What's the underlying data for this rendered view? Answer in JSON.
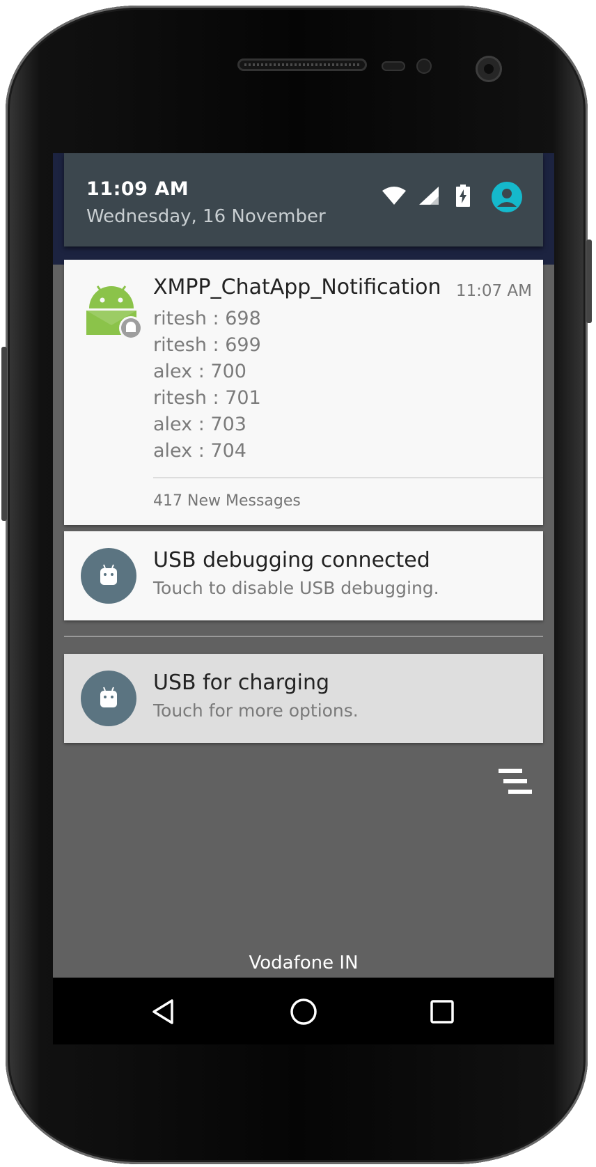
{
  "header": {
    "time": "11:09 AM",
    "date": "Wednesday, 16 November",
    "icons": [
      "wifi-icon",
      "cell-signal-icon",
      "battery-charging-icon",
      "user-avatar-icon"
    ]
  },
  "notifications": {
    "xmpp": {
      "title": "XMPP_ChatApp_Notification",
      "time": "11:07 AM",
      "messages": [
        "ritesh : 698",
        "ritesh : 699",
        "alex : 700",
        "ritesh : 701",
        "alex : 703",
        "alex : 704"
      ],
      "summary": "417 New Messages"
    },
    "usb_debug": {
      "title": "USB debugging connected",
      "text": "Touch to disable USB debugging."
    },
    "usb_charging": {
      "title": "USB for charging",
      "text": "Touch for more options."
    }
  },
  "carrier": "Vodafone IN",
  "colors": {
    "header_bg": "#3c474e",
    "shade_bg": "#616161",
    "avatar": "#15b9cc",
    "android_green": "#8bc34a",
    "usb_icon_bg": "#5b7481"
  }
}
